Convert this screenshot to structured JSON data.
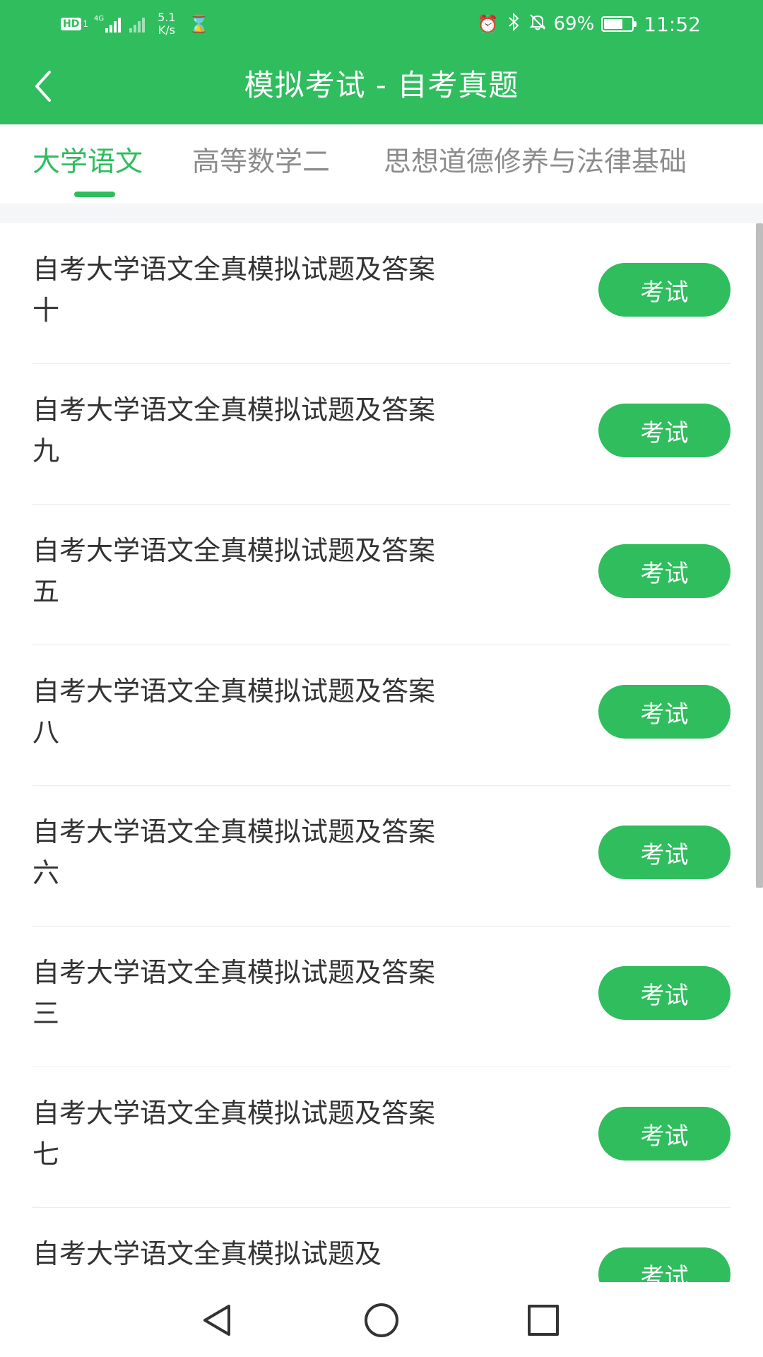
{
  "status_bar": {
    "hd_label": "HD",
    "sim_slot": "1",
    "network_type": "4G",
    "net_speed_value": "5.1",
    "net_speed_unit": "K/s",
    "battery_percent": "69%",
    "battery_level": 0.69,
    "time": "11:52",
    "icons": [
      "signal-icon",
      "signal-off-icon",
      "hourglass-icon",
      "alarm-icon",
      "bluetooth-icon",
      "mute-icon",
      "battery-icon"
    ]
  },
  "header": {
    "title": "模拟考试 - 自考真题",
    "back_icon": "chevron-left-icon"
  },
  "tabs": [
    {
      "label": "大学语文",
      "active": true
    },
    {
      "label": "高等数学二",
      "active": false
    },
    {
      "label": "思想道德修养与法律基础",
      "active": false
    }
  ],
  "exam_list": [
    {
      "title": "自考大学语文全真模拟试题及答案十",
      "button": "考试"
    },
    {
      "title": "自考大学语文全真模拟试题及答案九",
      "button": "考试"
    },
    {
      "title": "自考大学语文全真模拟试题及答案五",
      "button": "考试"
    },
    {
      "title": "自考大学语文全真模拟试题及答案八",
      "button": "考试"
    },
    {
      "title": "自考大学语文全真模拟试题及答案六",
      "button": "考试"
    },
    {
      "title": "自考大学语文全真模拟试题及答案三",
      "button": "考试"
    },
    {
      "title": "自考大学语文全真模拟试题及答案七",
      "button": "考试"
    },
    {
      "title": "自考大学语文全真模拟试题及",
      "button": "考试"
    }
  ],
  "nav_bar": {
    "icons": [
      "back-triangle-icon",
      "home-circle-icon",
      "recents-square-icon"
    ]
  },
  "colors": {
    "primary": "#2fbd5e",
    "text": "#333333",
    "inactive_tab": "#8c8c8c",
    "band": "#f4f6f8"
  }
}
